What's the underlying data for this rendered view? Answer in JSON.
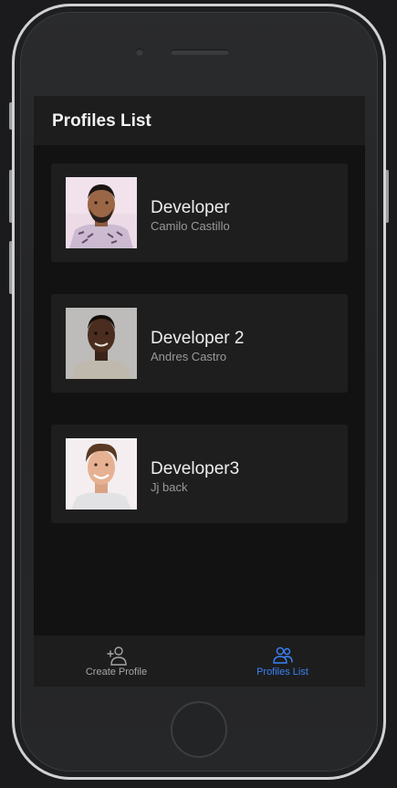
{
  "header": {
    "title": "Profiles List"
  },
  "profiles": [
    {
      "title": "Developer",
      "name": "Camilo Castillo"
    },
    {
      "title": "Developer 2",
      "name": "Andres Castro"
    },
    {
      "title": "Developer3",
      "name": "Jj back"
    }
  ],
  "tabbar": {
    "tabs": [
      {
        "label": "Create Profile",
        "icon": "add-user-icon",
        "active": false
      },
      {
        "label": "Profiles List",
        "icon": "users-icon",
        "active": true
      }
    ]
  },
  "colors": {
    "active_tab": "#3b82f6",
    "inactive_tab": "#a6a6a6",
    "screen_bg": "#121212",
    "card_bg": "#1e1e1f"
  }
}
